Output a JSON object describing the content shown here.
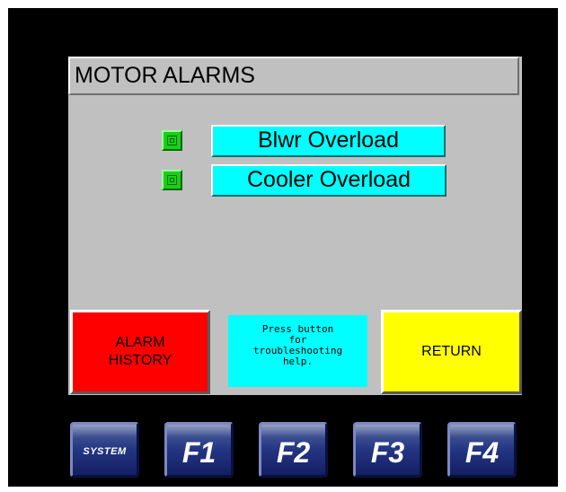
{
  "header": {
    "title": "MOTOR ALARMS"
  },
  "alarms": [
    {
      "label": "Blwr Overload",
      "indicator": "active",
      "color": "#19d019"
    },
    {
      "label": "Cooler Overload",
      "indicator": "active",
      "color": "#19d019"
    }
  ],
  "buttons": {
    "alarm_history": {
      "line1": "ALARM",
      "line2": "HISTORY",
      "color": "#ff0000"
    },
    "return": {
      "label": "RETURN",
      "color": "#ffff00"
    }
  },
  "help": {
    "lines": [
      "Press button",
      "for",
      "troubleshooting",
      "help."
    ]
  },
  "function_keys": [
    "SYSTEM",
    "F1",
    "F2",
    "F3",
    "F4"
  ],
  "colors": {
    "screen_bg": "#c0c0c0",
    "label_bg": "#00ffff",
    "fkey_bg": "#233582",
    "bezel": "#000000"
  }
}
